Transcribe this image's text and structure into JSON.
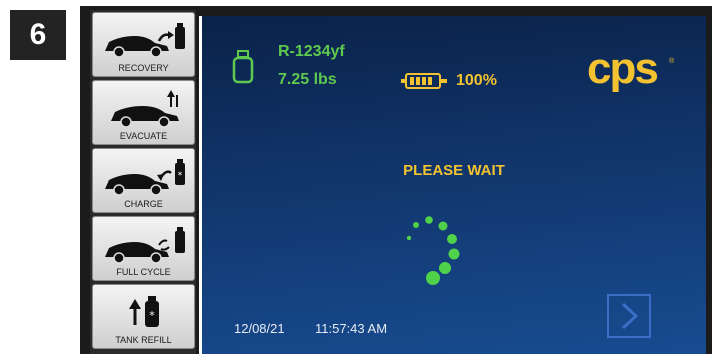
{
  "step": {
    "number": "6"
  },
  "sidebar": {
    "items": [
      {
        "label": "RECOVERY",
        "icon": "car-recovery-icon"
      },
      {
        "label": "EVACUATE",
        "icon": "car-evacuate-icon"
      },
      {
        "label": "CHARGE",
        "icon": "car-charge-icon"
      },
      {
        "label": "FULL CYCLE",
        "icon": "car-full-cycle-icon"
      },
      {
        "label": "TANK REFILL",
        "icon": "tank-refill-icon"
      }
    ]
  },
  "status": {
    "refrigerant": "R-1234yf",
    "weight": "7.25 lbs",
    "battery": "100%"
  },
  "brand": {
    "logo": "cps",
    "registered": "®"
  },
  "main": {
    "message": "PLEASE WAIT"
  },
  "footer": {
    "date": "12/08/21",
    "time": "11:57:43 AM"
  },
  "colors": {
    "accent_green": "#5fc94f",
    "accent_yellow": "#f2c230",
    "screen_blue": "#174c91"
  }
}
